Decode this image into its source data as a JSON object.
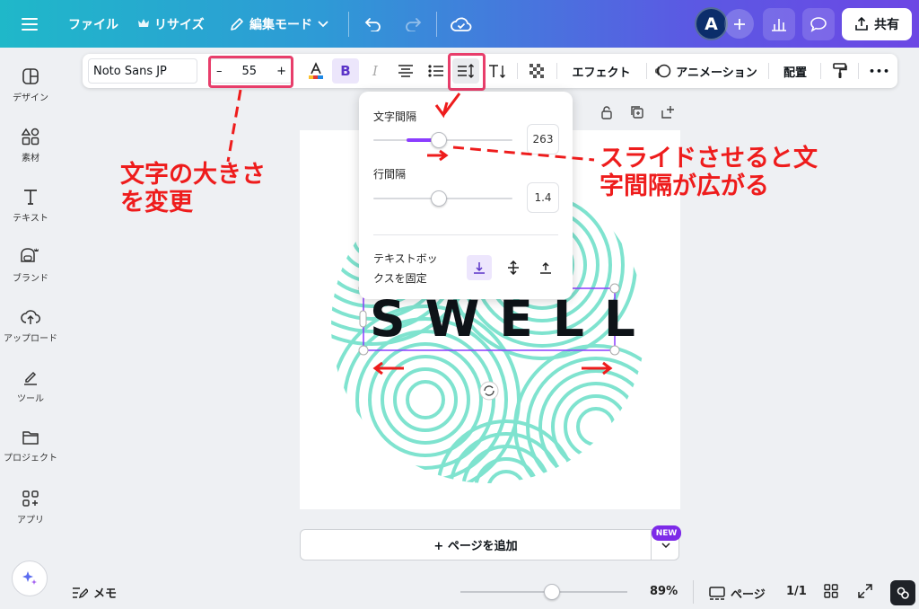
{
  "topbar": {
    "menu_icon": "hamburger-icon",
    "file_label": "ファイル",
    "resize_label": "リサイズ",
    "edit_mode_label": "編集モード",
    "avatar_initial": "A",
    "share_label": "共有"
  },
  "sidebar": {
    "items": [
      {
        "label": "デザイン",
        "icon": "design-icon"
      },
      {
        "label": "素材",
        "icon": "elements-icon"
      },
      {
        "label": "テキスト",
        "icon": "text-icon"
      },
      {
        "label": "ブランド",
        "icon": "brand-icon"
      },
      {
        "label": "アップロード",
        "icon": "upload-icon"
      },
      {
        "label": "ツール",
        "icon": "tools-icon"
      },
      {
        "label": "プロジェクト",
        "icon": "folder-icon"
      },
      {
        "label": "アプリ",
        "icon": "apps-icon"
      }
    ]
  },
  "toolbar": {
    "font_name": "Noto Sans JP",
    "font_size": "55",
    "minus": "–",
    "plus": "+",
    "bold_label": "B",
    "italic_label": "I",
    "effects_label": "エフェクト",
    "animation_label": "アニメーション",
    "position_label": "配置",
    "more_label": "•••",
    "text_color": "#e53935"
  },
  "popup": {
    "letter_spacing_label": "文字間隔",
    "letter_spacing_value": "263",
    "letter_spacing_fraction": 0.47,
    "line_spacing_label": "行間隔",
    "line_spacing_value": "1.4",
    "line_spacing_fraction": 0.47,
    "anchor_label_1": "テキストボッ",
    "anchor_label_2": "クスを固定"
  },
  "canvas": {
    "text": "SWELL",
    "pattern_color": "#7fe3cf"
  },
  "annotations": {
    "font_size_line1": "文字の大きさ",
    "font_size_line2": "を変更",
    "spacing_line1": "スライドさせると文",
    "spacing_line2": "字間隔が広がる"
  },
  "bottom": {
    "add_page_label": "+ ページを追加",
    "new_badge": "NEW",
    "memo_label": "メモ",
    "zoom_label": "89%",
    "zoom_fraction": 0.55,
    "pages_label": "ページ",
    "page_count": "1/1"
  },
  "colors": {
    "accent": "#7d2ae8",
    "highlight": "#e83e6b",
    "annotation": "#ee1c1c"
  }
}
